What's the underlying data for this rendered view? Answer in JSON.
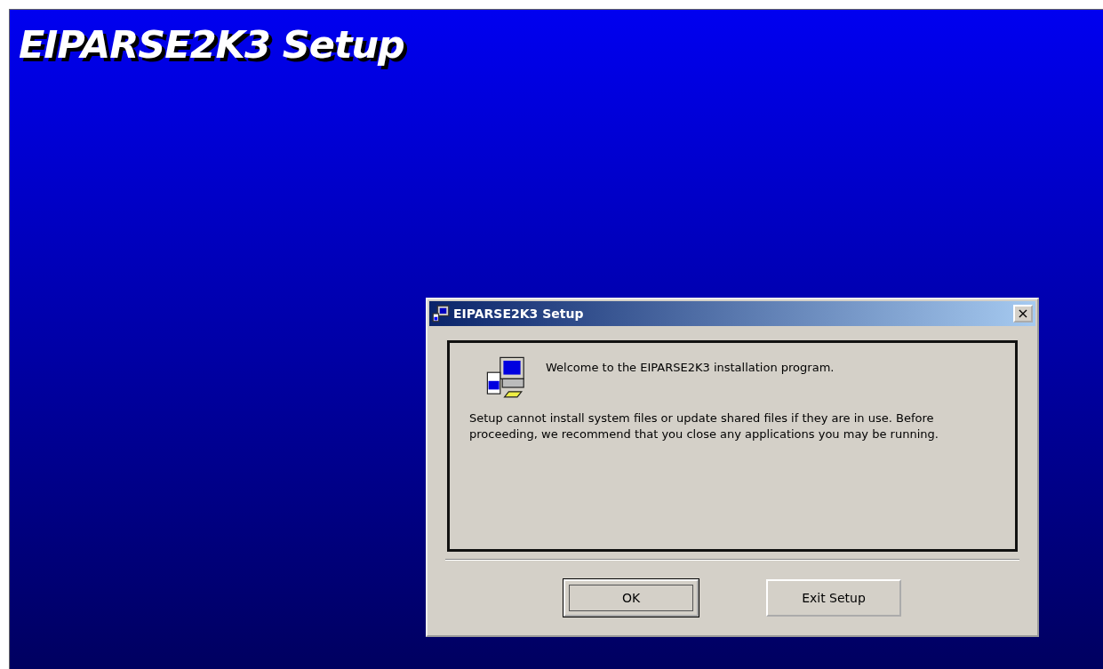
{
  "backdrop": {
    "title": "EIPARSE2K3 Setup"
  },
  "dialog": {
    "title": "EIPARSE2K3 Setup",
    "close": "×",
    "welcome": "Welcome to the EIPARSE2K3 installation program.",
    "message": "Setup cannot install system files or update shared files if they are in use. Before proceeding, we recommend that you close any applications you may be running.",
    "buttons": [
      {
        "label": "OK",
        "default": true
      },
      {
        "label": "Exit Setup",
        "default": false
      }
    ]
  }
}
